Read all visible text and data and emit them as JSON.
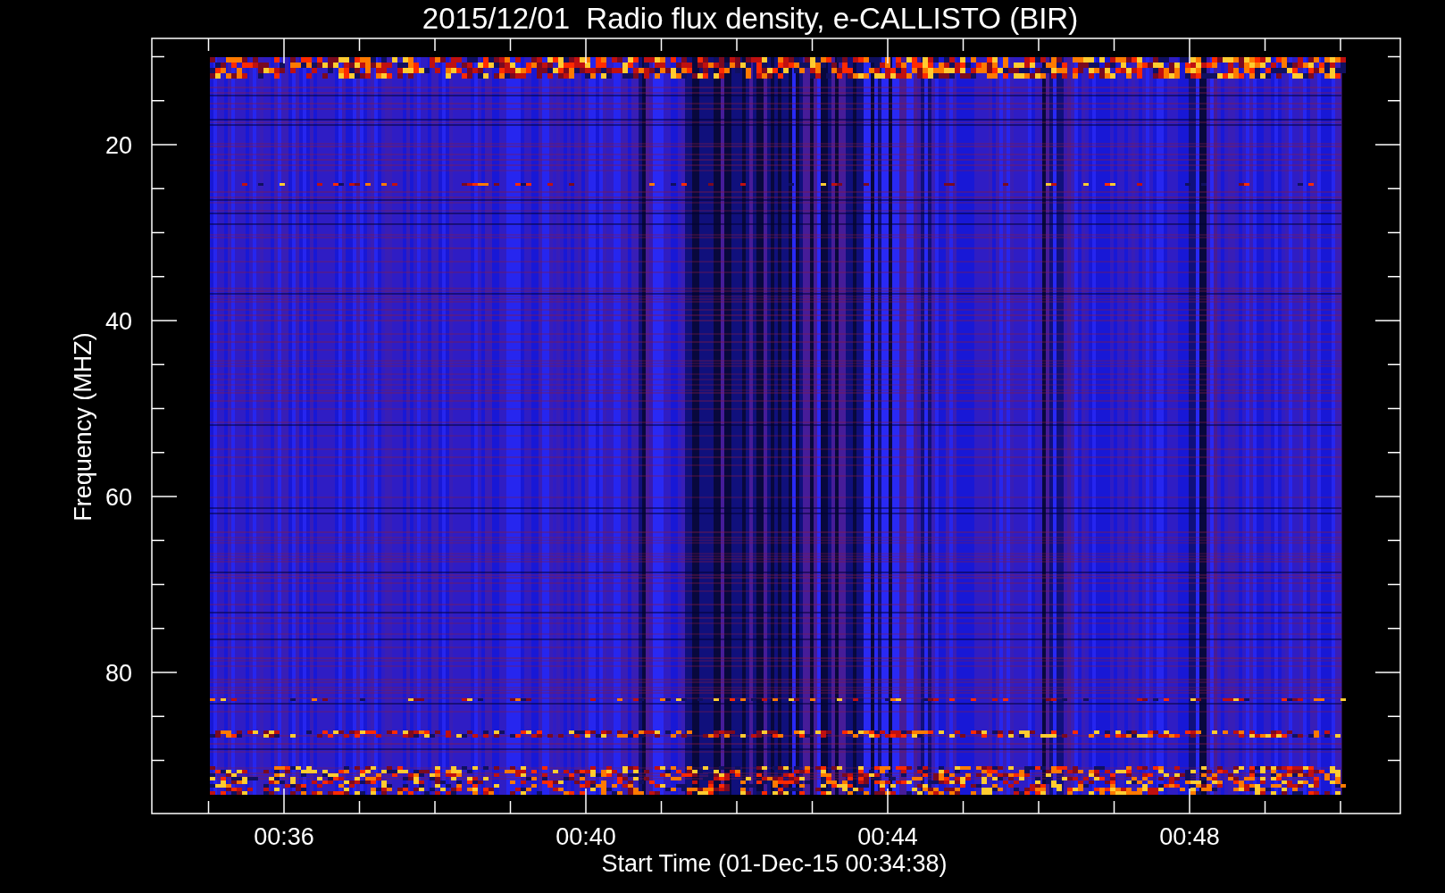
{
  "title": "2015/12/01  Radio flux density, e-CALLISTO (BIR)",
  "axes": {
    "ylabel": "Frequency (MHZ)",
    "xlabel": "Start Time (01-Dec-15 00:34:38)",
    "yticks": [
      "20",
      "40",
      "60",
      "80"
    ],
    "xticks": [
      "00:36",
      "00:40",
      "00:44",
      "00:48"
    ]
  }
}
